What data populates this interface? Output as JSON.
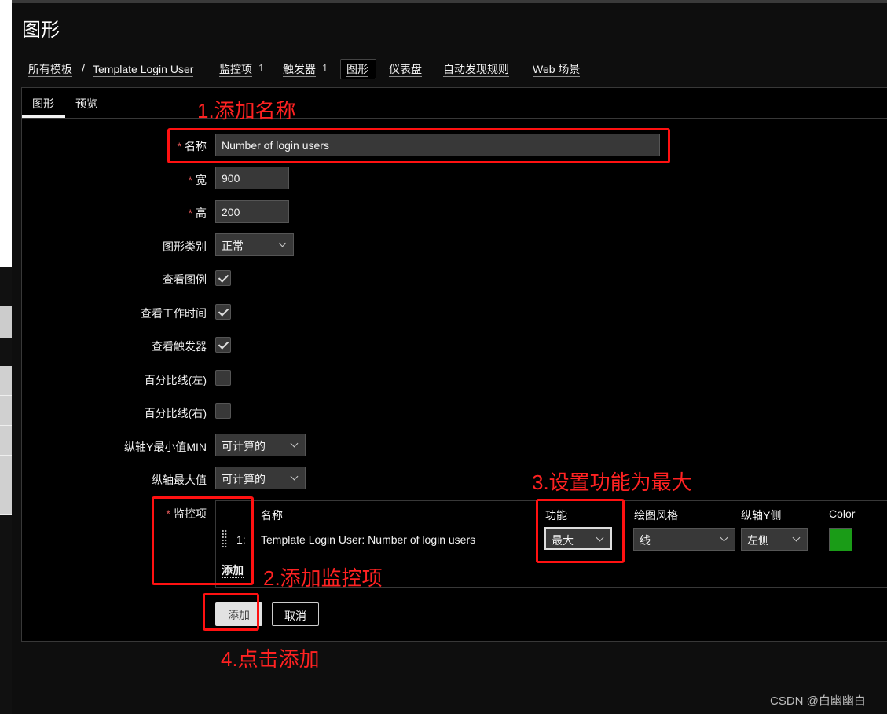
{
  "page": {
    "title": "图形"
  },
  "nav": {
    "items": [
      {
        "label": "所有模板"
      },
      {
        "sep": "/"
      },
      {
        "label": "Template Login User"
      },
      {
        "label": "监控项",
        "count": "1"
      },
      {
        "label": "触发器",
        "count": "1"
      },
      {
        "label": "图形"
      },
      {
        "label": "仪表盘"
      },
      {
        "label": "自动发现规则"
      },
      {
        "label": "Web 场景"
      }
    ]
  },
  "tabs": [
    {
      "label": "图形"
    },
    {
      "label": "预览"
    }
  ],
  "form": {
    "name": {
      "label": "名称",
      "value": "Number of login users"
    },
    "width": {
      "label": "宽",
      "value": "900"
    },
    "height": {
      "label": "高",
      "value": "200"
    },
    "graph_type": {
      "label": "图形类别",
      "value": "正常"
    },
    "show_legend": {
      "label": "查看图例",
      "checked": true
    },
    "show_work_period": {
      "label": "查看工作时间",
      "checked": true
    },
    "show_triggers": {
      "label": "查看触发器",
      "checked": true
    },
    "percentile_left": {
      "label": "百分比线(左)",
      "checked": false
    },
    "percentile_right": {
      "label": "百分比线(右)",
      "checked": false
    },
    "ymin": {
      "label": "纵轴Y最小值MIN",
      "value": "可计算的"
    },
    "ymax": {
      "label": "纵轴最大值",
      "value": "可计算的"
    },
    "items": {
      "label": "监控项",
      "headers": {
        "name": "名称",
        "function": "功能",
        "draw_style": "绘图风格",
        "y_side": "纵轴Y侧",
        "color": "Color"
      },
      "rows": [
        {
          "index": "1:",
          "name": "Template Login User: Number of login users",
          "function": "最大",
          "draw_style": "线",
          "y_side": "左侧",
          "color": "#1a9c17"
        }
      ],
      "add_link": "添加"
    }
  },
  "buttons": {
    "add": "添加",
    "cancel": "取消"
  },
  "annotations": {
    "a1": "1.添加名称",
    "a2": "2.添加监控项",
    "a3": "3.设置功能为最大",
    "a4": "4.点击添加",
    "color": "#ff1111"
  },
  "watermark": "CSDN @白幽幽白"
}
